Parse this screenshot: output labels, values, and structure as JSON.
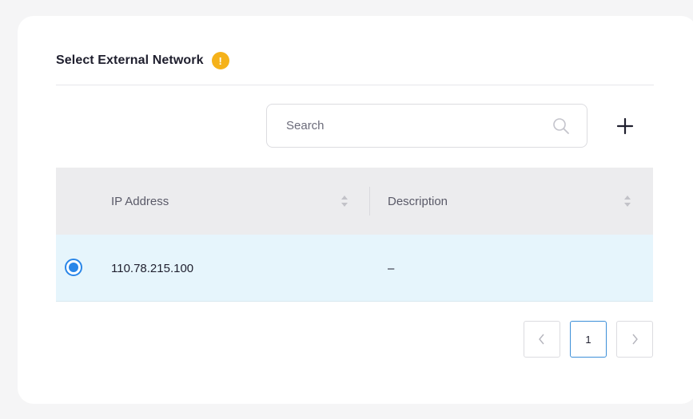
{
  "header": {
    "title": "Select External Network",
    "warning_icon": "exclamation-icon",
    "warning_glyph": "!",
    "warning_color": "#f5b21a"
  },
  "search": {
    "placeholder": "Search",
    "icon": "search-icon"
  },
  "toolbar": {
    "add_icon": "plus-icon"
  },
  "table": {
    "columns": [
      "IP Address",
      "Description"
    ],
    "rows": [
      {
        "selected": true,
        "ip_address": "110.78.215.100",
        "description": "–"
      }
    ],
    "selected_row_color": "#e6f5fc",
    "header_color": "#ececee",
    "accent_color": "#2a86e8"
  },
  "pagination": {
    "current_page": "1",
    "prev_icon": "chevron-left-icon",
    "next_icon": "chevron-right-icon"
  }
}
